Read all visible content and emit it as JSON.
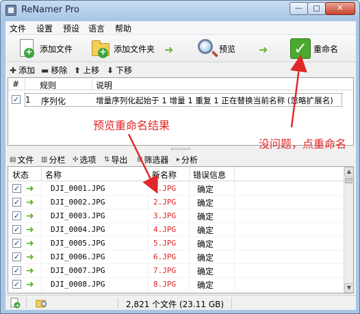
{
  "window": {
    "title": "ReNamer Pro",
    "min": "—",
    "max": "□",
    "close": "✕"
  },
  "menu": [
    "文件",
    "设置",
    "预设",
    "语言",
    "帮助"
  ],
  "toolbar": {
    "add_files": "添加文件",
    "add_folder": "添加文件夹",
    "preview": "预览",
    "rename": "重命名"
  },
  "rule_toolbar": {
    "add": "添加",
    "remove": "移除",
    "up": "上移",
    "down": "下移"
  },
  "rules_table": {
    "headers": [
      "#",
      "规则",
      "说明"
    ],
    "rows": [
      {
        "checked": true,
        "num": "1",
        "rule": "序列化",
        "desc": "增量序列化起始于 1 增量 1 重复 1 正在替换当前名称 (忽略扩展名)"
      }
    ]
  },
  "annotations": {
    "preview_result": "预览重命名结果",
    "click_rename": "没问题，点重命名",
    "color": "#e02828"
  },
  "files_toolbar": {
    "files": "文件",
    "columns": "分栏",
    "options": "选项",
    "export": "导出",
    "filter": "筛选器",
    "analyze": "分析"
  },
  "files_table": {
    "headers": [
      "状态",
      "名称",
      "新名称",
      "错误信息"
    ],
    "rows": [
      {
        "checked": true,
        "name": "DJI_0001.JPG",
        "new": "1.JPG",
        "error": "确定"
      },
      {
        "checked": true,
        "name": "DJI_0002.JPG",
        "new": "2.JPG",
        "error": "确定"
      },
      {
        "checked": true,
        "name": "DJI_0003.JPG",
        "new": "3.JPG",
        "error": "确定"
      },
      {
        "checked": true,
        "name": "DJI_0004.JPG",
        "new": "4.JPG",
        "error": "确定"
      },
      {
        "checked": true,
        "name": "DJI_0005.JPG",
        "new": "5.JPG",
        "error": "确定"
      },
      {
        "checked": true,
        "name": "DJI_0006.JPG",
        "new": "6.JPG",
        "error": "确定"
      },
      {
        "checked": true,
        "name": "DJI_0007.JPG",
        "new": "7.JPG",
        "error": "确定"
      },
      {
        "checked": true,
        "name": "DJI_0008.JPG",
        "new": "8.JPG",
        "error": "确定"
      }
    ]
  },
  "status": {
    "text": "2,821 个文件 (23.11 GB)"
  },
  "colors": {
    "accent_green": "#4aa92e",
    "new_name_red": "#e02020"
  }
}
